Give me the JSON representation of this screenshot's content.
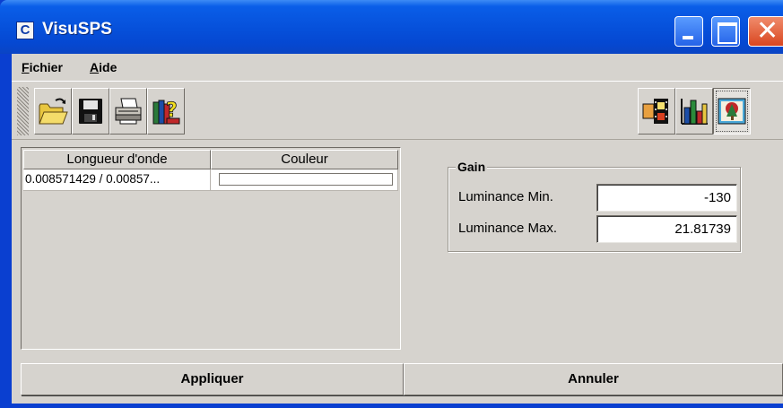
{
  "window": {
    "title": "VisuSPS",
    "app_icon_glyph": "C",
    "close_glyph": "✕"
  },
  "menu": {
    "items": [
      {
        "mnemonic": "F",
        "rest": "ichier"
      },
      {
        "mnemonic": "A",
        "rest": "ide"
      }
    ]
  },
  "toolbar": {
    "left_tools": [
      "open-folder-icon",
      "save-floppy-icon",
      "print-icon",
      "help-books-icon"
    ],
    "right_tools": [
      "film-frames-icon",
      "bar-chart-icon",
      "image-tree-icon"
    ],
    "pressed_tool": "image-tree-icon"
  },
  "table": {
    "columns": [
      "Longueur d'onde",
      "Couleur"
    ],
    "rows": [
      {
        "wavelength": "0.008571429 / 0.00857...",
        "color": "#ffffff"
      }
    ]
  },
  "gain": {
    "title": "Gain",
    "fields": [
      {
        "label": "Luminance Min.",
        "value": "-130"
      },
      {
        "label": "Luminance Max.",
        "value": "21.81739"
      }
    ]
  },
  "buttons": {
    "apply": "Appliquer",
    "cancel": "Annuler"
  }
}
